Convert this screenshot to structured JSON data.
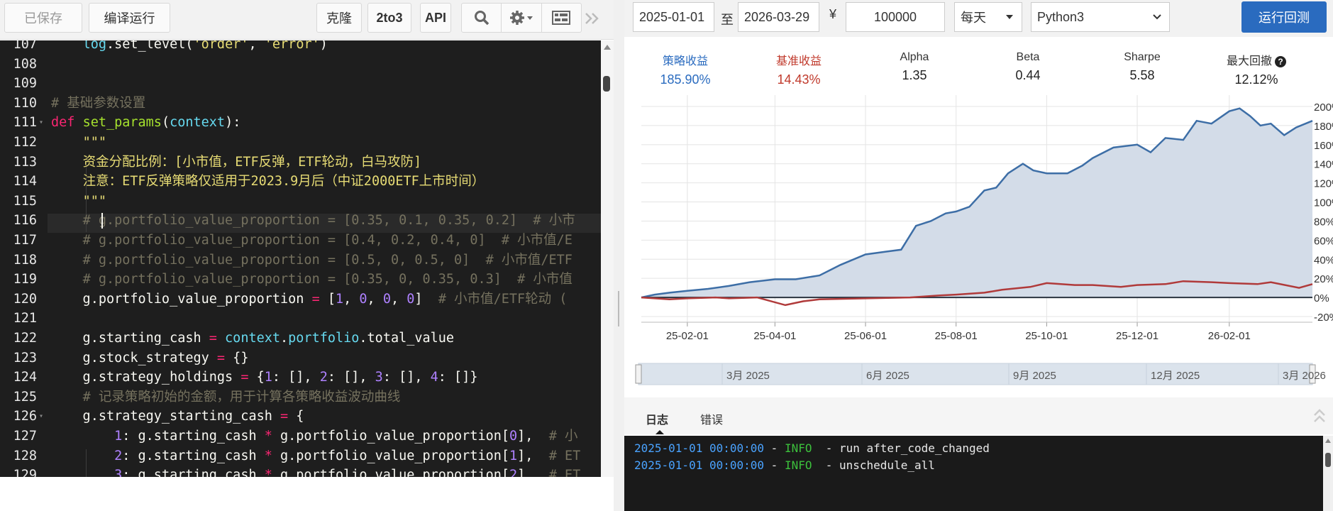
{
  "toolbar": {
    "saved_label": "已保存",
    "compile_label": "编译运行",
    "clone_label": "克隆",
    "to3_label": "2to3",
    "api_label": "API",
    "search_icon": "search-icon",
    "settings_icon": "gear-icon",
    "layout_icon": "layout-icon",
    "collapse_icon": "double-chevron-right-icon"
  },
  "editor": {
    "lines": [
      {
        "n": "107",
        "fold": false
      },
      {
        "n": "108",
        "fold": false
      },
      {
        "n": "109",
        "fold": false
      },
      {
        "n": "110",
        "fold": false
      },
      {
        "n": "111",
        "fold": true
      },
      {
        "n": "112",
        "fold": false
      },
      {
        "n": "113",
        "fold": false
      },
      {
        "n": "114",
        "fold": false
      },
      {
        "n": "115",
        "fold": false
      },
      {
        "n": "116",
        "fold": false
      },
      {
        "n": "117",
        "fold": false
      },
      {
        "n": "118",
        "fold": false
      },
      {
        "n": "119",
        "fold": false
      },
      {
        "n": "120",
        "fold": false
      },
      {
        "n": "121",
        "fold": false
      },
      {
        "n": "122",
        "fold": false
      },
      {
        "n": "123",
        "fold": false
      },
      {
        "n": "124",
        "fold": false
      },
      {
        "n": "125",
        "fold": false
      },
      {
        "n": "126",
        "fold": true
      },
      {
        "n": "127",
        "fold": false
      },
      {
        "n": "128",
        "fold": false
      },
      {
        "n": "129",
        "fold": false
      }
    ],
    "code": [
      [
        [
          "",
          "    "
        ],
        [
          "var",
          "log"
        ],
        [
          "",
          ".set_level("
        ],
        [
          "str",
          "'order'"
        ],
        [
          "",
          ", "
        ],
        [
          "str",
          "'error'"
        ],
        [
          "",
          ")"
        ]
      ],
      [],
      [],
      [
        [
          "cm",
          "# 基础参数设置"
        ]
      ],
      [
        [
          "kw",
          "def "
        ],
        [
          "fn",
          "set_params"
        ],
        [
          "",
          "("
        ],
        [
          "var",
          "context"
        ],
        [
          "",
          "):"
        ]
      ],
      [
        [
          "",
          "    "
        ],
        [
          "str",
          "\"\"\""
        ]
      ],
      [
        [
          "",
          "    "
        ],
        [
          "str",
          "资金分配比例：[小市值，ETF反弹，ETF轮动，白马攻防]"
        ]
      ],
      [
        [
          "",
          "    "
        ],
        [
          "str",
          "注意：ETF反弹策略仅适用于2023.9月后（中证2000ETF上市时间）"
        ]
      ],
      [
        [
          "",
          "    "
        ],
        [
          "str",
          "\"\"\""
        ]
      ],
      [
        [
          "",
          "    "
        ],
        [
          "cm",
          "# g.portfolio_value_proportion = [0.35, 0.1, 0.35, 0.2]  # 小市"
        ]
      ],
      [
        [
          "",
          "    "
        ],
        [
          "cm",
          "# g.portfolio_value_proportion = [0.4, 0.2, 0.4, 0]  # 小市值/E"
        ]
      ],
      [
        [
          "",
          "    "
        ],
        [
          "cm",
          "# g.portfolio_value_proportion = [0.5, 0, 0.5, 0]  # 小市值/ETF"
        ]
      ],
      [
        [
          "",
          "    "
        ],
        [
          "cm",
          "# g.portfolio_value_proportion = [0.35, 0, 0.35, 0.3]  # 小市值"
        ]
      ],
      [
        [
          "",
          "    g.portfolio_value_proportion "
        ],
        [
          "op",
          "="
        ],
        [
          "",
          " ["
        ],
        [
          "num",
          "1"
        ],
        [
          "",
          ", "
        ],
        [
          "num",
          "0"
        ],
        [
          "",
          ", "
        ],
        [
          "num",
          "0"
        ],
        [
          "",
          ", "
        ],
        [
          "num",
          "0"
        ],
        [
          "",
          "]  "
        ],
        [
          "cm",
          "# 小市值/ETF轮动 ("
        ]
      ],
      [],
      [
        [
          "",
          "    g.starting_cash "
        ],
        [
          "op",
          "="
        ],
        [
          "",
          " "
        ],
        [
          "var",
          "context"
        ],
        [
          "",
          "."
        ],
        [
          "var",
          "portfolio"
        ],
        [
          "",
          ".total_value"
        ]
      ],
      [
        [
          "",
          "    g.stock_strategy "
        ],
        [
          "op",
          "="
        ],
        [
          "",
          " {}"
        ]
      ],
      [
        [
          "",
          "    g.strategy_holdings "
        ],
        [
          "op",
          "="
        ],
        [
          "",
          " {"
        ],
        [
          "num",
          "1"
        ],
        [
          "",
          ": [], "
        ],
        [
          "num",
          "2"
        ],
        [
          "",
          ": [], "
        ],
        [
          "num",
          "3"
        ],
        [
          "",
          ": [], "
        ],
        [
          "num",
          "4"
        ],
        [
          "",
          ": []}"
        ]
      ],
      [
        [
          "",
          "    "
        ],
        [
          "cm",
          "# 记录策略初始的金额，用于计算各策略收益波动曲线"
        ]
      ],
      [
        [
          "",
          "    g.strategy_starting_cash "
        ],
        [
          "op",
          "="
        ],
        [
          "",
          " {"
        ]
      ],
      [
        [
          "",
          "        "
        ],
        [
          "num",
          "1"
        ],
        [
          "",
          ": g.starting_cash "
        ],
        [
          "op",
          "*"
        ],
        [
          "",
          " g.portfolio_value_proportion["
        ],
        [
          "num",
          "0"
        ],
        [
          "",
          "],  "
        ],
        [
          "cm",
          "# 小"
        ]
      ],
      [
        [
          "",
          "        "
        ],
        [
          "num",
          "2"
        ],
        [
          "",
          ": g.starting_cash "
        ],
        [
          "op",
          "*"
        ],
        [
          "",
          " g.portfolio_value_proportion["
        ],
        [
          "num",
          "1"
        ],
        [
          "",
          "],  "
        ],
        [
          "cm",
          "# ET"
        ]
      ],
      [
        [
          "",
          "        "
        ],
        [
          "num",
          "3"
        ],
        [
          "",
          ": g.starting_cash "
        ],
        [
          "op",
          "*"
        ],
        [
          "",
          " g.portfolio_value_proportion["
        ],
        [
          "num",
          "2"
        ],
        [
          "",
          "],  "
        ],
        [
          "cm",
          "# ET"
        ]
      ]
    ]
  },
  "backtest": {
    "start_date": "2025-01-01",
    "to_label": "至",
    "end_date": "2026-03-29",
    "currency_symbol": "¥",
    "capital": "100000",
    "frequency": "每天",
    "python_version": "Python3",
    "run_label": "运行回测"
  },
  "metrics": [
    {
      "label": "策略收益",
      "value": "185.90%",
      "color": "#2a6bbf"
    },
    {
      "label": "基准收益",
      "value": "14.43%",
      "color": "#c0392b"
    },
    {
      "label": "Alpha",
      "value": "1.35",
      "color": "#222222"
    },
    {
      "label": "Beta",
      "value": "0.44",
      "color": "#222222"
    },
    {
      "label": "Sharpe",
      "value": "5.58",
      "color": "#222222"
    },
    {
      "label": "最大回撤",
      "value": "12.12%",
      "color": "#222222"
    }
  ],
  "chart_data": {
    "type": "area",
    "x_tick_labels": [
      "25-02-01",
      "25-04-01",
      "25-06-01",
      "25-08-01",
      "25-10-01",
      "25-12-01",
      "26-02-01"
    ],
    "y_tick_labels": [
      "200%",
      "180%",
      "160%",
      "140%",
      "120%",
      "100%",
      "80%",
      "60%",
      "40%",
      "20%",
      "0%",
      "-20%"
    ],
    "ylim": [
      -20,
      200
    ],
    "grid": true,
    "series": [
      {
        "color": "#3d6ea6",
        "fill": "#d3dce8",
        "points": [
          [
            "2025-01-01",
            0
          ],
          [
            "2025-01-10",
            3
          ],
          [
            "2025-01-20",
            5
          ],
          [
            "2025-02-01",
            7
          ],
          [
            "2025-02-15",
            9
          ],
          [
            "2025-03-01",
            12
          ],
          [
            "2025-03-15",
            16
          ],
          [
            "2025-04-01",
            19
          ],
          [
            "2025-04-15",
            19
          ],
          [
            "2025-05-01",
            23
          ],
          [
            "2025-05-15",
            34
          ],
          [
            "2025-06-01",
            45
          ],
          [
            "2025-06-15",
            48
          ],
          [
            "2025-06-25",
            50
          ],
          [
            "2025-07-05",
            75
          ],
          [
            "2025-07-15",
            80
          ],
          [
            "2025-07-25",
            88
          ],
          [
            "2025-08-01",
            90
          ],
          [
            "2025-08-10",
            95
          ],
          [
            "2025-08-20",
            112
          ],
          [
            "2025-08-28",
            115
          ],
          [
            "2025-09-05",
            130
          ],
          [
            "2025-09-15",
            140
          ],
          [
            "2025-09-22",
            133
          ],
          [
            "2025-10-01",
            130
          ],
          [
            "2025-10-15",
            130
          ],
          [
            "2025-10-25",
            138
          ],
          [
            "2025-11-01",
            146
          ],
          [
            "2025-11-15",
            157
          ],
          [
            "2025-12-01",
            160
          ],
          [
            "2025-12-10",
            152
          ],
          [
            "2025-12-20",
            167
          ],
          [
            "2026-01-01",
            165
          ],
          [
            "2026-01-10",
            185
          ],
          [
            "2026-01-20",
            182
          ],
          [
            "2026-02-01",
            195
          ],
          [
            "2026-02-08",
            198
          ],
          [
            "2026-02-15",
            190
          ],
          [
            "2026-02-22",
            180
          ],
          [
            "2026-03-01",
            182
          ],
          [
            "2026-03-10",
            170
          ],
          [
            "2026-03-18",
            178
          ],
          [
            "2026-03-29",
            185
          ]
        ]
      },
      {
        "color": "#b03a3a",
        "points": [
          [
            "2025-01-01",
            0
          ],
          [
            "2025-01-20",
            -2
          ],
          [
            "2025-02-01",
            -1
          ],
          [
            "2025-02-20",
            0
          ],
          [
            "2025-03-01",
            -1
          ],
          [
            "2025-03-20",
            0
          ],
          [
            "2025-04-08",
            -8
          ],
          [
            "2025-04-20",
            -4
          ],
          [
            "2025-05-01",
            -2
          ],
          [
            "2025-06-01",
            -1
          ],
          [
            "2025-07-01",
            0
          ],
          [
            "2025-07-20",
            2
          ],
          [
            "2025-08-01",
            3
          ],
          [
            "2025-08-20",
            5
          ],
          [
            "2025-09-01",
            8
          ],
          [
            "2025-09-20",
            11
          ],
          [
            "2025-10-01",
            15
          ],
          [
            "2025-10-20",
            13
          ],
          [
            "2025-11-01",
            13
          ],
          [
            "2025-11-20",
            11
          ],
          [
            "2025-12-01",
            13
          ],
          [
            "2025-12-20",
            14
          ],
          [
            "2026-01-01",
            17
          ],
          [
            "2026-01-20",
            16
          ],
          [
            "2026-02-01",
            15
          ],
          [
            "2026-02-20",
            14
          ],
          [
            "2026-03-01",
            16
          ],
          [
            "2026-03-20",
            10
          ],
          [
            "2026-03-29",
            14
          ]
        ]
      }
    ]
  },
  "range_selector": {
    "labels": [
      "3月 2025",
      "6月 2025",
      "9月 2025",
      "12月 2025",
      "3月 2026"
    ]
  },
  "log": {
    "tab_log": "日志",
    "tab_error": "错误",
    "lines": [
      {
        "time": "2025-01-01 00:00:00",
        "sep": " - ",
        "level": "INFO",
        "msg": "  - run after_code_changed"
      },
      {
        "time": "2025-01-01 00:00:00",
        "sep": " - ",
        "level": "INFO",
        "msg": "  - unschedule_all"
      }
    ]
  }
}
